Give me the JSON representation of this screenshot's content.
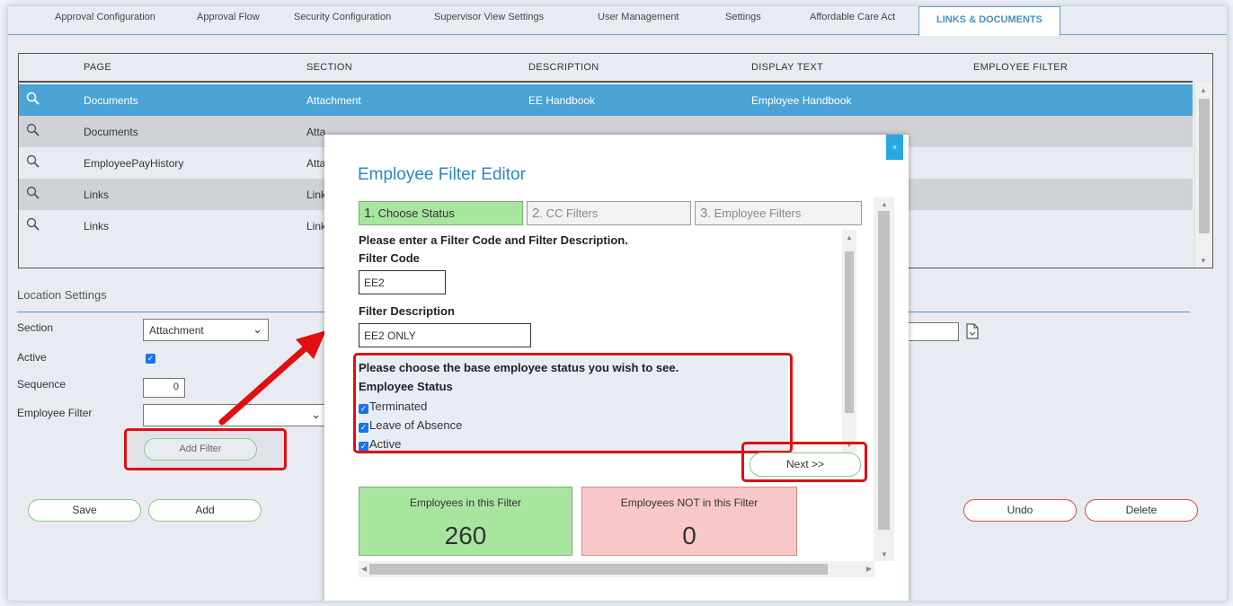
{
  "tabs": [
    "Approval Configuration",
    "Approval Flow",
    "Security Configuration",
    "Supervisor View Settings",
    "User Management",
    "Settings",
    "Affordable Care Act",
    "LINKS & DOCUMENTS"
  ],
  "table": {
    "columns": [
      "PAGE",
      "SECTION",
      "DESCRIPTION",
      "DISPLAY TEXT",
      "EMPLOYEE FILTER"
    ],
    "rows": [
      {
        "page": "Documents",
        "section": "Attachment",
        "description": "EE Handbook",
        "display": "Employee Handbook"
      },
      {
        "page": "Documents",
        "section": "Atta"
      },
      {
        "page": "EmployeePayHistory",
        "section": "Atta"
      },
      {
        "page": "Links",
        "section": "Link"
      },
      {
        "page": "Links",
        "section": "Link"
      }
    ]
  },
  "location": {
    "title": "Location Settings",
    "section_label": "Section",
    "section_value": "Attachment",
    "active_label": "Active",
    "sequence_label": "Sequence",
    "sequence_value": "0",
    "filter_label": "Employee Filter",
    "filter_value": "",
    "add_filter": "Add Filter",
    "save": "Save",
    "add": "Add",
    "undo": "Undo",
    "delete": "Delete"
  },
  "modal": {
    "close": "×",
    "title": "Employee Filter Editor",
    "steps": [
      {
        "num": "1",
        "label": ". Choose Status"
      },
      {
        "num": "2",
        "label": ". CC Filters"
      },
      {
        "num": "3",
        "label": ". Employee Filters"
      }
    ],
    "instructions": "Please enter a Filter Code and Filter Description.",
    "filter_code_label": "Filter Code",
    "filter_code_value": "EE2",
    "filter_desc_label": "Filter Description",
    "filter_desc_value": "EE2 ONLY",
    "status_prompt": "Please choose the base employee status you wish to see.",
    "status_label": "Employee Status",
    "statuses": [
      "Terminated",
      "Leave of Absence",
      "Active"
    ],
    "next": "Next >>",
    "in_filter_label": "Employees in this Filter",
    "in_filter_value": "260",
    "not_in_filter_label": "Employees NOT in this Filter",
    "not_in_filter_value": "0"
  },
  "colors": {
    "selected_row": "#4aa3d4",
    "accent": "#2d86c4",
    "highlight": "#e01010",
    "green_panel": "#a8e6a0",
    "red_panel": "#f8c8c8"
  }
}
